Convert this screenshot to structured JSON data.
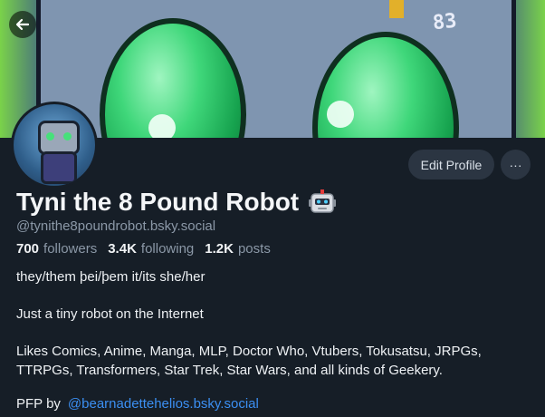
{
  "profile": {
    "display_name": "Tyni the 8 Pound Robot",
    "name_emoji_icon": "robot-face-icon",
    "handle": "@tynithe8poundrobot.bsky.social",
    "stats": {
      "followers_count": "700",
      "followers_label": "followers",
      "following_count": "3.4K",
      "following_label": "following",
      "posts_count": "1.2K",
      "posts_label": "posts"
    },
    "bio": {
      "pronouns": "they/them þei/þem it/its she/her",
      "tagline": "Just a tiny robot on the Internet",
      "interests": "Likes Comics, Anime, Manga, MLP, Doctor Who, Vtubers, Tokusatsu, JRPGs, TTRPGs, Transformers, Star Trek, Star Wars, and all kinds of Geekery.",
      "pfp_prefix": "PFP by",
      "pfp_link": "@bearnadettehelios.bsky.social"
    }
  },
  "banner": {
    "number": "83"
  },
  "actions": {
    "edit_label": "Edit Profile",
    "more_label": "···",
    "back_icon": "arrow-left-icon"
  },
  "colors": {
    "background": "#161e27",
    "button": "#2b3542",
    "link": "#3b8ff2",
    "muted": "#8b98a7"
  }
}
